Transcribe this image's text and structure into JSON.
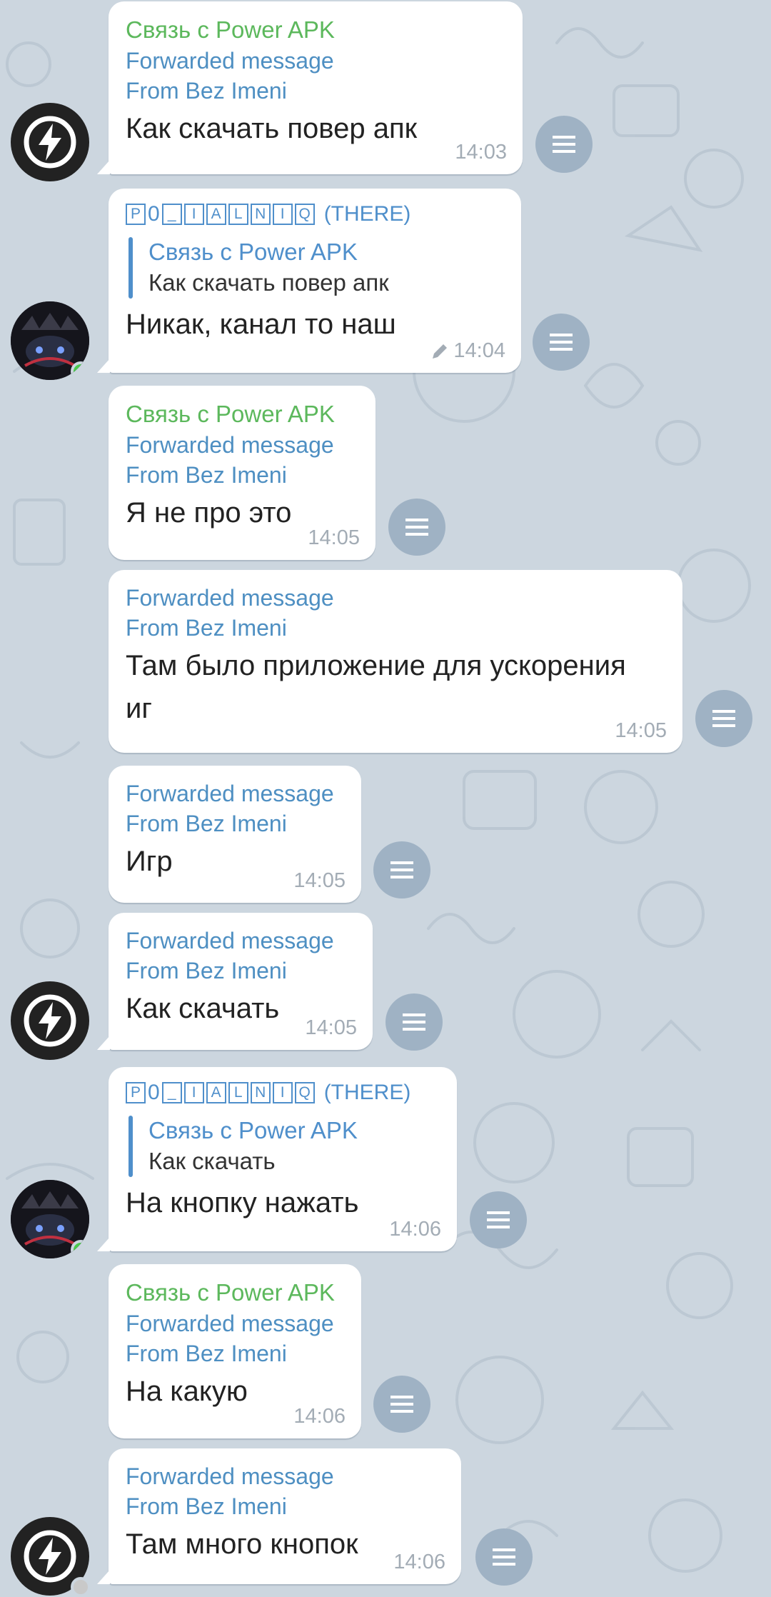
{
  "messages": [
    {
      "sender": "Связь с Power APK",
      "fwd1": "Forwarded message",
      "fwd2": "From Bez Imeni",
      "text": "Как скачать повер апк",
      "time": "14:03"
    },
    {
      "sender_boxes": [
        "P",
        "0",
        "_",
        "I",
        "A",
        "L",
        "N",
        "I",
        "Q"
      ],
      "sender_tag": "(THERE)",
      "reply_name": "Связь с Power APK",
      "reply_text": "Как скачать повер апк",
      "text": "Никак, канал то наш",
      "time": "14:04"
    },
    {
      "sender": "Связь с Power APK",
      "fwd1": "Forwarded message",
      "fwd2": "From Bez Imeni",
      "text": "Я не про это",
      "time": "14:05"
    },
    {
      "fwd1": "Forwarded message",
      "fwd2": "From Bez Imeni",
      "text": "Там было приложение для ускорения иг",
      "time": "14:05"
    },
    {
      "fwd1": "Forwarded message",
      "fwd2": "From Bez Imeni",
      "text": "Игр",
      "time": "14:05"
    },
    {
      "fwd1": "Forwarded message",
      "fwd2": "From Bez Imeni",
      "text": "Как скачать",
      "time": "14:05"
    },
    {
      "sender_boxes": [
        "P",
        "0",
        "_",
        "I",
        "A",
        "L",
        "N",
        "I",
        "Q"
      ],
      "sender_tag": "(THERE)",
      "reply_name": "Связь с Power APK",
      "reply_text": "Как скачать",
      "text": "На кнопку нажать",
      "time": "14:06"
    },
    {
      "sender": "Связь с Power APK",
      "fwd1": "Forwarded message",
      "fwd2": "From Bez Imeni",
      "text": "На какую",
      "time": "14:06"
    },
    {
      "fwd1": "Forwarded message",
      "fwd2": "From Bez Imeni",
      "text": "Там много кнопок",
      "time": "14:06"
    }
  ],
  "icons": {
    "share": "share-icon",
    "bolt_avatar": "lightning-bolt-icon",
    "edited": "pencil-icon"
  },
  "colors": {
    "background": "#ccd6df",
    "sender": "#5cb85c",
    "forwarded": "#4e8fc2",
    "share_button": "#9fb2c4",
    "online": "#4cc94c"
  }
}
